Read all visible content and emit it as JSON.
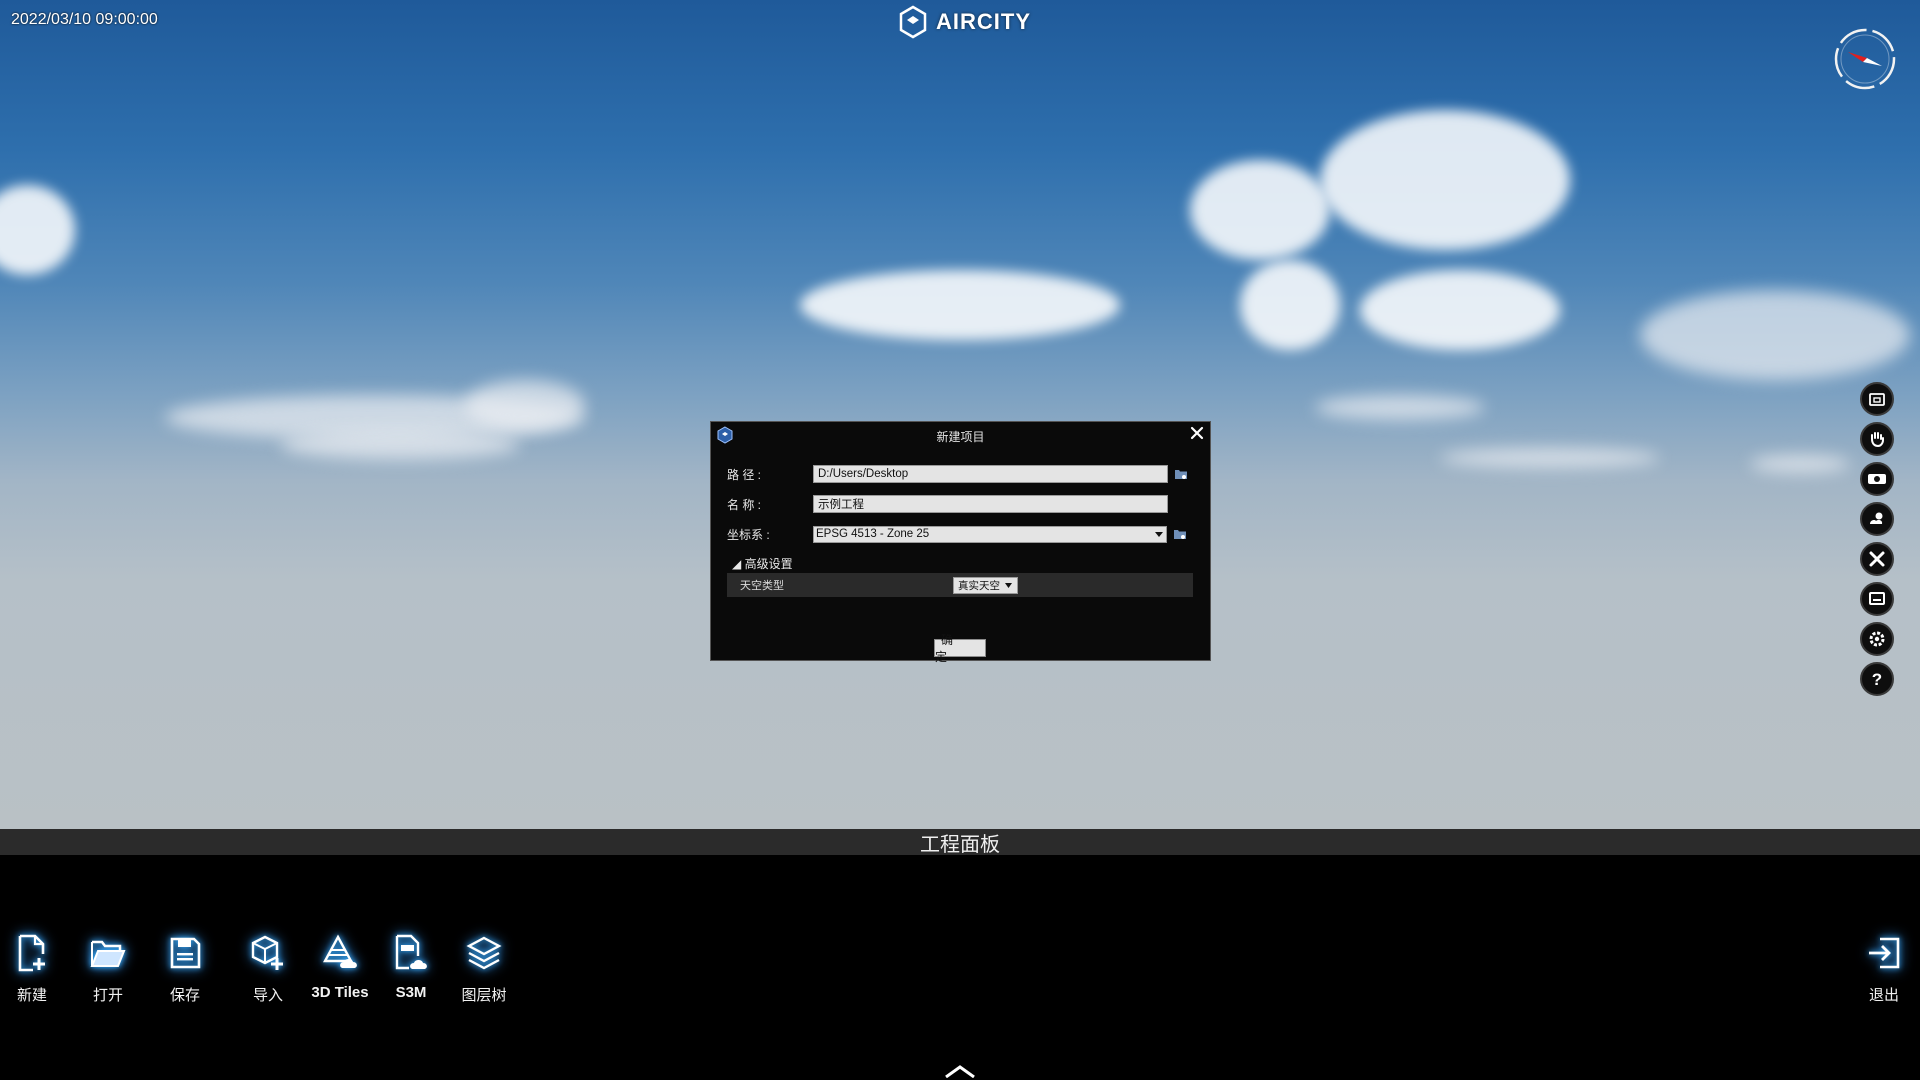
{
  "top": {
    "datetime": "2022/03/10   09:00:00",
    "logo_text": "AIRCITY"
  },
  "dialog": {
    "title": "新建项目",
    "path_label": "路  径 :",
    "path_value": "D:/Users/Desktop",
    "name_label": "名  称 :",
    "name_value": "示例工程",
    "crs_label": "坐标系 :",
    "crs_value": "EPSG  4513 - Zone 25",
    "advanced_label": "◢ 高级设置",
    "sky_type_label": "天空类型",
    "sky_type_value": "真实天空",
    "ok_label": "确 定"
  },
  "panel": {
    "title": "工程面板"
  },
  "toolbar": {
    "new_label": "新建",
    "open_label": "打开",
    "save_label": "保存",
    "import_label": "导入",
    "tiles_label": "3D Tiles",
    "s3m_label": "S3M",
    "layer_tree_label": "图层树",
    "exit_label": "退出"
  },
  "side_tools": [
    "folder-icon",
    "hand-icon",
    "camera-icon",
    "weather-icon",
    "measure-icon",
    "monitor-icon",
    "gear-icon",
    "help-icon"
  ]
}
